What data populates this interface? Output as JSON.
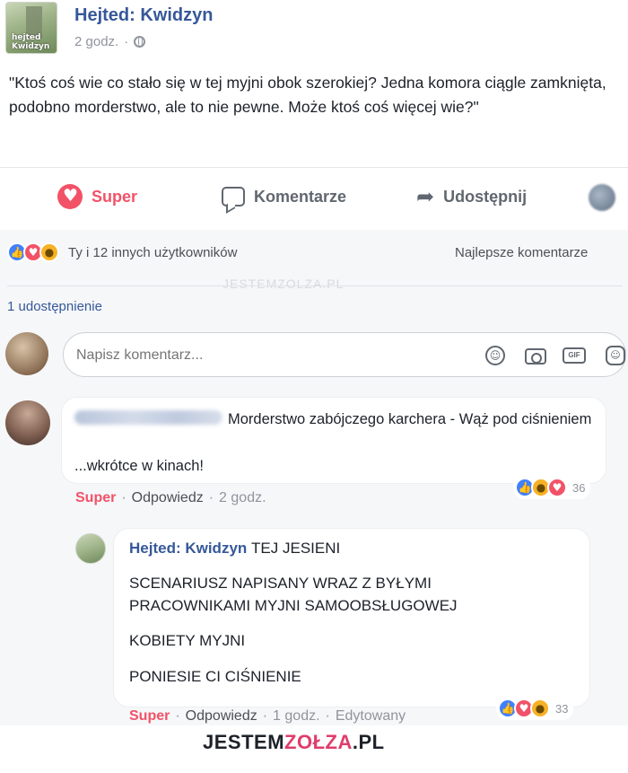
{
  "post": {
    "page_name": "Hejted: Kwidzyn",
    "time": "2 godz.",
    "separator": "·",
    "avatar_label": "hejted\nKwidzyn",
    "text": "\"Ktoś coś wie co stało się w tej myjni obok szerokiej? Jedna komora ciągle zamknięta, podobno morderstwo, ale to nie pewne. Może ktoś coś więcej wie?\""
  },
  "actions": {
    "super": "Super",
    "comment": "Komentarze",
    "share": "Udostępnij"
  },
  "feedback": {
    "reactors": "Ty i 12 innych użytkowników",
    "sort": "Najlepsze komentarze",
    "shares": "1 udostępnienie",
    "watermark": "JESTEMZOLZA.PL"
  },
  "composer": {
    "placeholder": "Napisz komentarz...",
    "gif_label": "GIF"
  },
  "comment": {
    "text_line1": "Morderstwo zabójczego karchera - Wąż pod ciśnieniem",
    "text_line2": "...wkrótce w kinach!",
    "reaction_count": "36",
    "super_label": "Super",
    "reply_label": "Odpowiedz",
    "time": "2 godz."
  },
  "reply": {
    "author": "Hejted: Kwidzyn",
    "line1": "TEJ JESIENI",
    "line2": "SCENARIUSZ NAPISANY WRAZ Z BYŁYMI PRACOWNIKAMI MYJNI SAMOOBSŁUGOWEJ",
    "line3": "KOBIETY MYJNI",
    "line4": "PONIESIE CI CIŚNIENIE",
    "reaction_count": "33",
    "super_label": "Super",
    "reply_label": "Odpowiedz",
    "time": "1 godz.",
    "edited": "Edytowany"
  },
  "footer": {
    "logo_part1": "JESTEM",
    "logo_part2": "ZOŁZA",
    "logo_part3": ".PL"
  },
  "colors": {
    "link_blue": "#365899",
    "super_red": "#f25268",
    "like_blue": "#4080ff",
    "haha_yellow": "#f7b125"
  }
}
